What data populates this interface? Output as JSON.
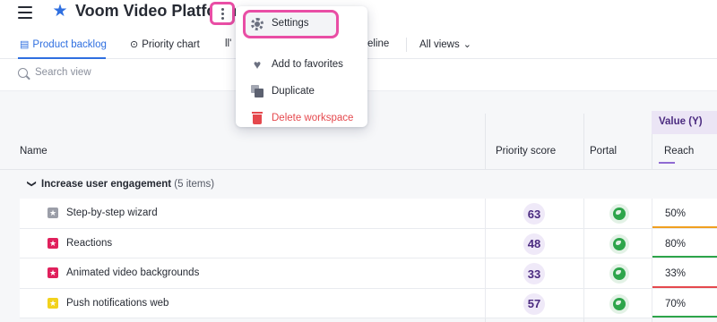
{
  "header": {
    "title": "Voom Video Platform"
  },
  "tabs": [
    {
      "label": "Product backlog",
      "icon": "list-icon",
      "active": true
    },
    {
      "label": "Priority chart",
      "icon": "target-icon",
      "active": false
    },
    {
      "label": "ll'",
      "icon": "",
      "active": false
    },
    {
      "label": "eline",
      "icon": "",
      "active": false
    },
    {
      "label": "All views",
      "icon": "chevron-down-icon",
      "active": false
    }
  ],
  "search": {
    "placeholder": "Search view"
  },
  "table": {
    "columns": {
      "name": "Name",
      "priority_score": "Priority score",
      "portal": "Portal",
      "value_group": "Value (Y)",
      "reach": "Reach"
    },
    "group": {
      "label": "Increase user engagement",
      "count": "(5 items)"
    },
    "rows": [
      {
        "name": "Step-by-step wizard",
        "score": "63",
        "reach": "50%",
        "icon_color": "#9b9ea8",
        "bar_color": "#f0a020"
      },
      {
        "name": "Reactions",
        "score": "48",
        "reach": "80%",
        "icon_color": "#e0205c",
        "bar_color": "#2da54a"
      },
      {
        "name": "Animated video backgrounds",
        "score": "33",
        "reach": "33%",
        "icon_color": "#e0205c",
        "bar_color": "#e5484d"
      },
      {
        "name": "Push notifications web",
        "score": "57",
        "reach": "70%",
        "icon_color": "#f2d21c",
        "bar_color": "#2da54a"
      }
    ]
  },
  "menu": {
    "items": [
      {
        "label": "Settings",
        "icon": "gear-icon"
      },
      {
        "label": "Add to favorites",
        "icon": "heart-icon"
      },
      {
        "label": "Duplicate",
        "icon": "duplicate-icon"
      },
      {
        "label": "Delete workspace",
        "icon": "trash-icon"
      }
    ]
  },
  "colors": {
    "accent": "#2f6fe0",
    "highlight": "#e94ea5",
    "danger": "#e5484d",
    "score_text": "#4b2b80"
  }
}
